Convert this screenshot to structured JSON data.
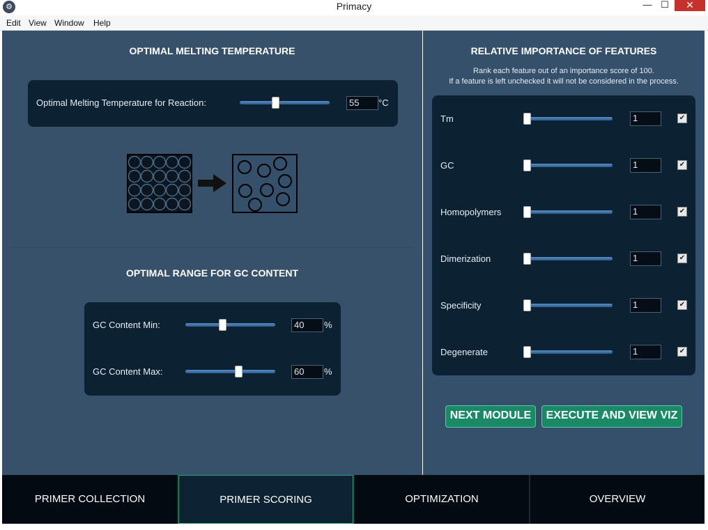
{
  "window": {
    "title": "Primacy",
    "min_glyph": "—",
    "max_glyph": "☐",
    "close_glyph": "✕",
    "app_icon_glyph": "⚙"
  },
  "menu": {
    "items": [
      "Edit",
      "View",
      "Window",
      "Help"
    ]
  },
  "melting": {
    "title": "OPTIMAL MELTING TEMPERATURE",
    "label": "Optimal Melting Temperature for Reaction:",
    "value": "55",
    "unit": "°C",
    "slider_fraction": 0.39
  },
  "gc": {
    "title": "OPTIMAL RANGE FOR GC CONTENT",
    "min_label": "GC Content Min:",
    "min_value": "40",
    "max_label": "GC Content Max:",
    "max_value": "60",
    "unit": "%",
    "min_slider_fraction": 0.4,
    "max_slider_fraction": 0.6
  },
  "features": {
    "title": "RELATIVE IMPORTANCE OF FEATURES",
    "desc1": "Rank each feature out of an importance score of 100.",
    "desc2": "If a feature is left unchecked it will not be considered in the process.",
    "check_glyph": "✔",
    "items": [
      {
        "label": "Tm",
        "value": "1",
        "checked": true
      },
      {
        "label": "GC",
        "value": "1",
        "checked": true
      },
      {
        "label": "Homopolymers",
        "value": "1",
        "checked": true
      },
      {
        "label": "Dimerization",
        "value": "1",
        "checked": true
      },
      {
        "label": "Specificity",
        "value": "1",
        "checked": true
      },
      {
        "label": "Degenerate",
        "value": "1",
        "checked": true
      }
    ]
  },
  "buttons": {
    "next": "NEXT MODULE",
    "execute": "EXECUTE AND VIEW VIZ"
  },
  "nav": {
    "tabs": [
      "PRIMER COLLECTION",
      "PRIMER SCORING",
      "OPTIMIZATION",
      "OVERVIEW"
    ],
    "active": 1
  }
}
